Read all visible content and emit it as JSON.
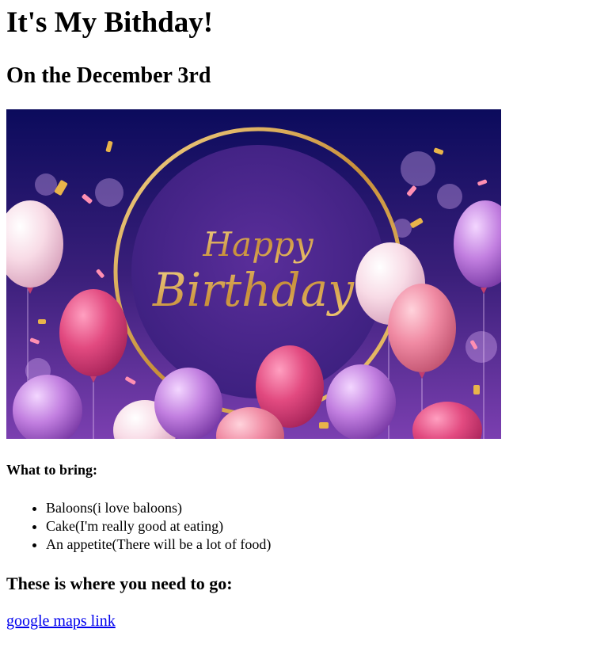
{
  "page": {
    "title": "It's My Bithday!",
    "subtitle": "On the December 3rd"
  },
  "banner": {
    "text_line1": "Happy",
    "text_line2": "Birthday",
    "colors": {
      "bg_top": "#0b0b5c",
      "bg_mid": "#3a1f7a",
      "bg_bottom": "#7b3fb0",
      "ring": "#d4a24a",
      "gold_text": "#e9c06e",
      "balloon_pink": "#e24a80",
      "balloon_light": "#f6cfe0",
      "balloon_purple": "#b56ad6"
    }
  },
  "bring": {
    "heading": "What to bring:",
    "items": [
      "Baloons(i love baloons)",
      "Cake(I'm really good at eating)",
      "An appetite(There will be a lot of food)"
    ]
  },
  "directions": {
    "heading": "These is where you need to go:",
    "link_text": "google maps link"
  }
}
